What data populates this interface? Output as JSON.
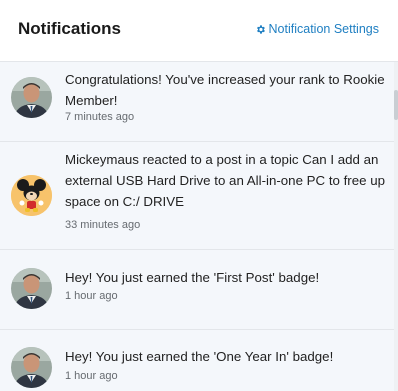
{
  "header": {
    "title": "Notifications",
    "settings_label": "Notification Settings"
  },
  "notifications": [
    {
      "avatar": "user-photo",
      "text": "Congratulations! You've increased your rank to Rookie Member!",
      "time": "7 minutes ago"
    },
    {
      "avatar": "mickey-mouse-avatar",
      "text": "Mickeymaus reacted to a post in a topic Can I add an external USB Hard Drive to an All-in-one PC to free up space on C:/ DRIVE",
      "time": "33 minutes ago"
    },
    {
      "avatar": "user-photo",
      "text": "Hey! You just earned the 'First Post' badge!",
      "time": "1 hour ago"
    },
    {
      "avatar": "user-photo",
      "text": "Hey! You just earned the 'One Year In' badge!",
      "time": "1 hour ago"
    }
  ],
  "colors": {
    "accent": "#1f7fc2",
    "list_background": "#f4f7fb",
    "mickey_background": "#f7c36b"
  }
}
